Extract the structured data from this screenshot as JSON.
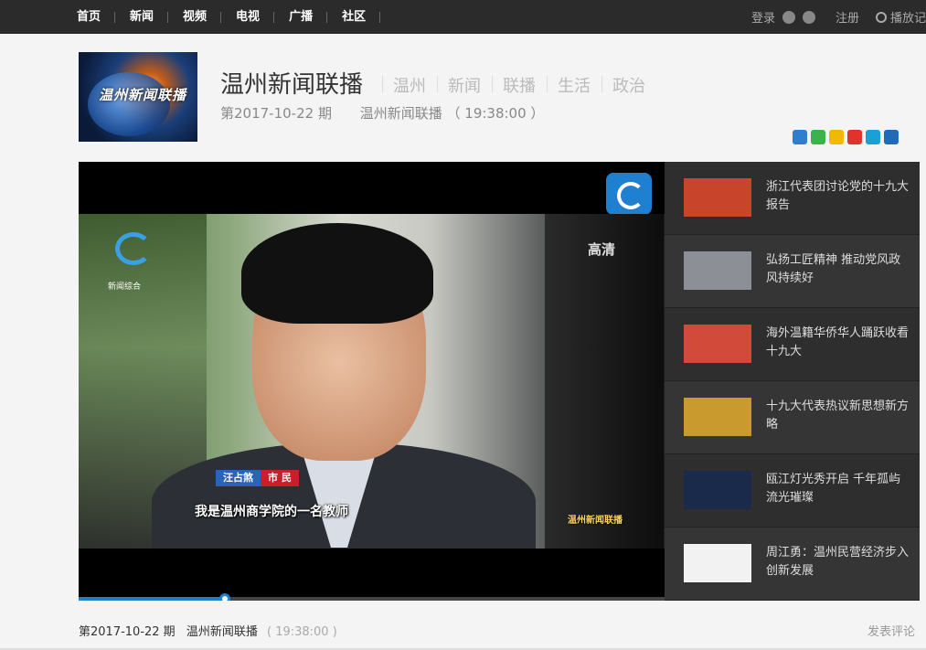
{
  "nav": {
    "items": [
      "首页",
      "新闻",
      "视频",
      "电视",
      "广播",
      "社区"
    ],
    "login": "登录",
    "register": "注册",
    "history": "播放记"
  },
  "program": {
    "title": "温州新闻联播",
    "tags": [
      "温州",
      "新闻",
      "联播",
      "生活",
      "政治"
    ],
    "episode": "第2017-10-22 期",
    "show_time": "温州新闻联播 （ 19:38:00 ）",
    "thumb_title": "温州新闻联播"
  },
  "video": {
    "hd_label": "高清",
    "channel_label": "新闻综合",
    "person_name": "汪占煞",
    "person_role": "市 民",
    "caption": "我是温州商学院的一名教师",
    "program_bug": "温州新闻联播",
    "progress": 0.25
  },
  "playlist": [
    {
      "title": "浙江代表团讨论党的十九大报告",
      "thumb_color": "#c8452c"
    },
    {
      "title": "弘扬工匠精神 推动党风政风持续好",
      "thumb_color": "#8d8f96"
    },
    {
      "title": "海外温籍华侨华人踊跃收看十九大",
      "thumb_color": "#d24a3a"
    },
    {
      "title": "十九大代表热议新思想新方略",
      "thumb_color": "#c99a2e"
    },
    {
      "title": "瓯江灯光秀开启 千年孤屿流光璀璨",
      "thumb_color": "#1a2a4a"
    },
    {
      "title": "周江勇：温州民营经济步入创新发展",
      "thumb_color": "#f2f2f2"
    }
  ],
  "footer": {
    "episode": "第2017-10-22 期",
    "show": "温州新闻联播",
    "time": "( 19:38:00 )",
    "comment": "发表评论"
  },
  "colors": {
    "topbar": "#2b2b2b",
    "accent": "#1b82d1",
    "playlist_bg": "#2e2e2e"
  }
}
